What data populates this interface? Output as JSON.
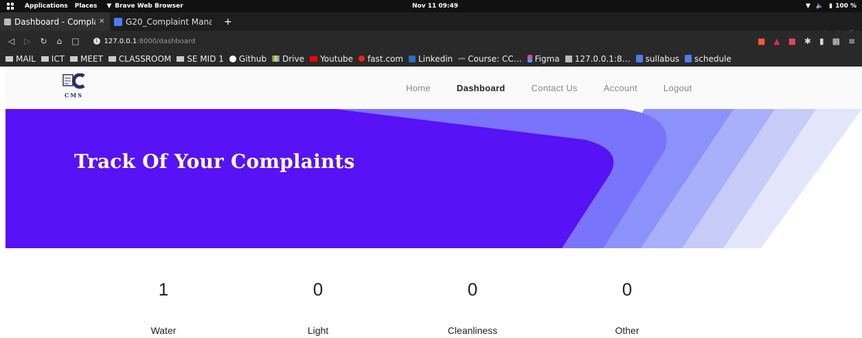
{
  "system_bar": {
    "applications": "Applications",
    "places": "Places",
    "browser_name": "Brave Web Browser",
    "clock": "Nov 11  09:49",
    "battery": "100 %"
  },
  "tabs": [
    {
      "title": "Dashboard - Complai",
      "active": true
    },
    {
      "title": "G20_Complaint Manag",
      "active": false
    }
  ],
  "address": {
    "host": "127.0.0.1",
    "path": ":8000/dashboard"
  },
  "bookmarks": [
    {
      "label": "MAIL",
      "icon": "folder-icon"
    },
    {
      "label": "ICT",
      "icon": "folder-icon"
    },
    {
      "label": "MEET",
      "icon": "folder-icon"
    },
    {
      "label": "CLASSROOM",
      "icon": "folder-icon"
    },
    {
      "label": "SE MID 1",
      "icon": "folder-icon"
    },
    {
      "label": "Github",
      "icon": "github-icon"
    },
    {
      "label": "Drive",
      "icon": "drive-icon"
    },
    {
      "label": "Youtube",
      "icon": "youtube-icon"
    },
    {
      "label": "fast.com",
      "icon": "fast-icon"
    },
    {
      "label": "Linkedin",
      "icon": "linkedin-icon"
    },
    {
      "label": "Course: CC…",
      "icon": "course-icon"
    },
    {
      "label": "Figma",
      "icon": "figma-icon"
    },
    {
      "label": "127.0.0.1:8…",
      "icon": "site-icon"
    },
    {
      "label": "sullabus",
      "icon": "doc-icon"
    },
    {
      "label": "schedule",
      "icon": "doc-icon"
    }
  ],
  "site": {
    "logo_text": "CMS",
    "nav": [
      {
        "label": "Home",
        "active": false
      },
      {
        "label": "Dashboard",
        "active": true
      },
      {
        "label": "Contact Us",
        "active": false
      },
      {
        "label": "Account",
        "active": false
      },
      {
        "label": "Logout",
        "active": false
      }
    ],
    "hero_title": "Track Of Your Complaints",
    "accent": "#5712f5",
    "stats": [
      {
        "count": "1",
        "label": "Water"
      },
      {
        "count": "0",
        "label": "Light"
      },
      {
        "count": "0",
        "label": "Cleanliness"
      },
      {
        "count": "0",
        "label": "Other"
      }
    ]
  }
}
